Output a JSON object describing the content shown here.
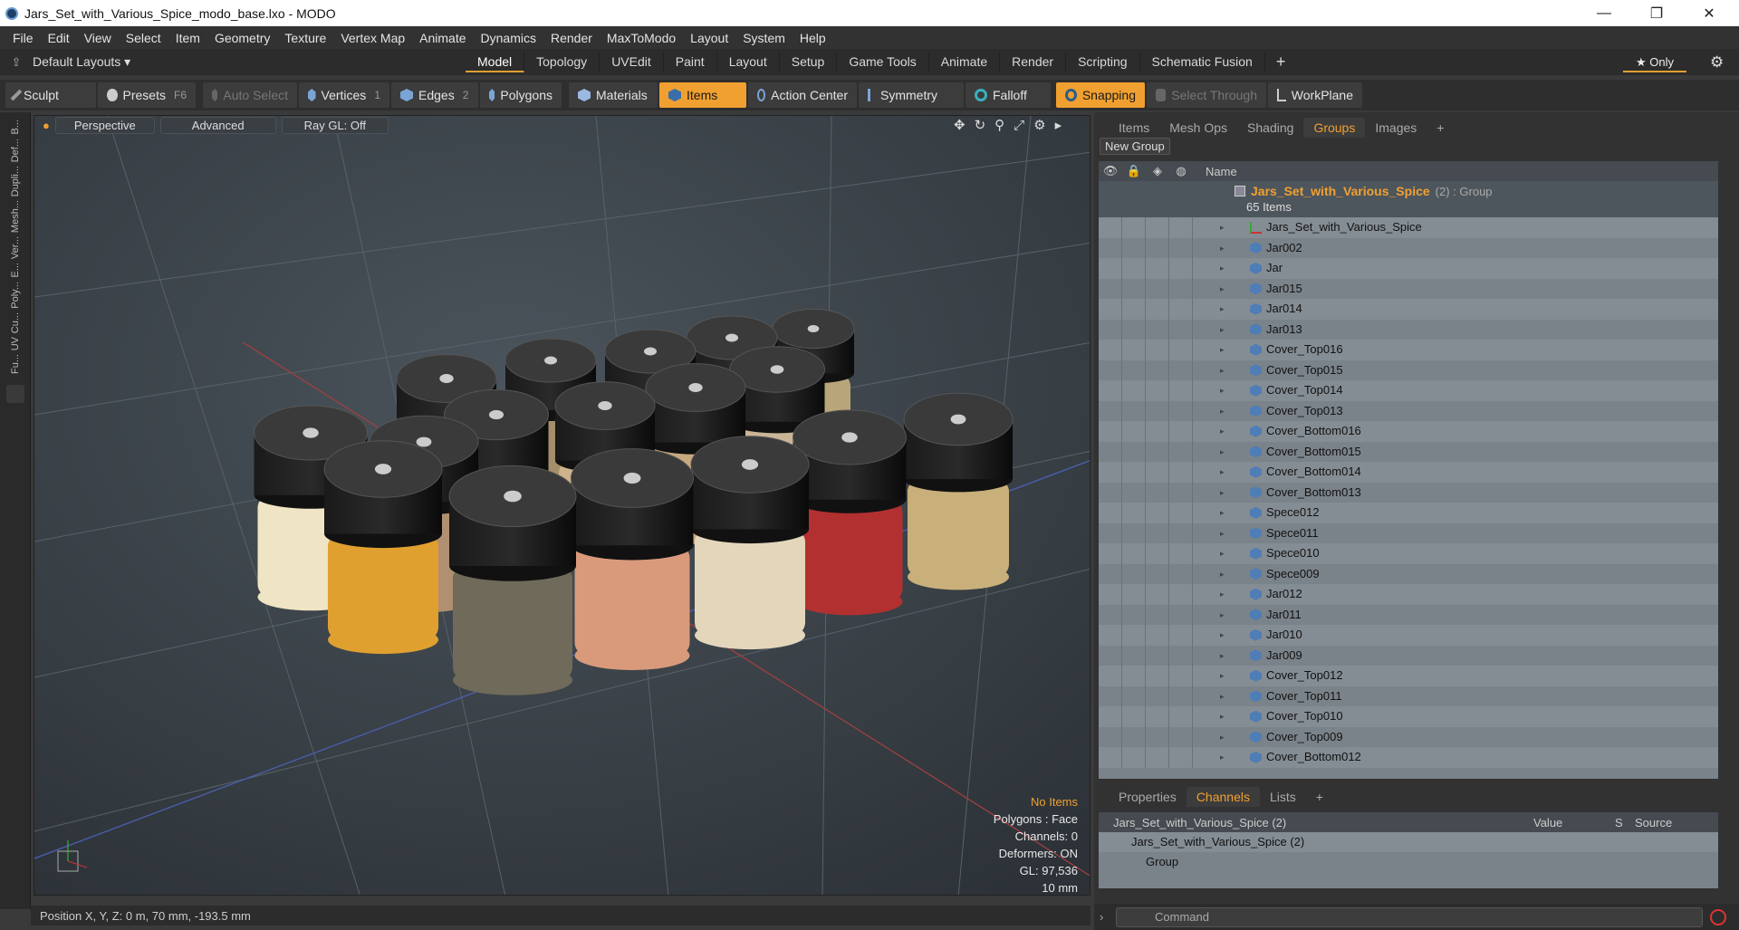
{
  "window": {
    "title": "Jars_Set_with_Various_Spice_modo_base.lxo - MODO",
    "min": "—",
    "max": "❐",
    "close": "✕"
  },
  "menu": [
    "File",
    "Edit",
    "View",
    "Select",
    "Item",
    "Geometry",
    "Texture",
    "Vertex Map",
    "Animate",
    "Dynamics",
    "Render",
    "MaxToModo",
    "Layout",
    "System",
    "Help"
  ],
  "layouts": {
    "label": "Default Layouts ▾",
    "only": "★ Only"
  },
  "tabs": [
    "Model",
    "Topology",
    "UVEdit",
    "Paint",
    "Layout",
    "Setup",
    "Game Tools",
    "Animate",
    "Render",
    "Scripting",
    "Schematic Fusion"
  ],
  "toolbar": {
    "sculpt": "Sculpt",
    "presets": "Presets",
    "presets_key": "F6",
    "auto_select": "Auto Select",
    "vertices": "Vertices",
    "vertices_n": "1",
    "edges": "Edges",
    "edges_n": "2",
    "polygons": "Polygons",
    "materials": "Materials",
    "items": "Items",
    "action_center": "Action Center",
    "symmetry": "Symmetry",
    "falloff": "Falloff",
    "snapping": "Snapping",
    "select_through": "Select Through",
    "workplane": "WorkPlane"
  },
  "left_tools": [
    "B...",
    "Def...",
    "Dupli...",
    "Mesh...",
    "Ver...",
    "E...",
    "Poly...",
    "Cu...",
    "UV",
    "Fu..."
  ],
  "viewport": {
    "perspective": "Perspective",
    "advanced": "Advanced",
    "raygl": "Ray GL: Off",
    "stats": {
      "items": "No Items",
      "polygons": "Polygons : Face",
      "channels": "Channels: 0",
      "deformers": "Deformers: ON",
      "gl": "GL: 97,536",
      "unit": "10 mm"
    }
  },
  "status": "Position X, Y, Z:  0 m, 70 mm, -193.5 mm",
  "groups_panel": {
    "tabs": [
      "Items",
      "Mesh Ops",
      "Shading",
      "Groups",
      "Images"
    ],
    "new_group": "New Group",
    "name_col": "Name",
    "group_name": "Jars_Set_with_Various_Spice",
    "group_suffix": "(2) : Group",
    "group_count": "65 Items",
    "items": [
      "Jars_Set_with_Various_Spice",
      "Jar002",
      "Jar",
      "Jar015",
      "Jar014",
      "Jar013",
      "Cover_Top016",
      "Cover_Top015",
      "Cover_Top014",
      "Cover_Top013",
      "Cover_Bottom016",
      "Cover_Bottom015",
      "Cover_Bottom014",
      "Cover_Bottom013",
      "Spece012",
      "Spece011",
      "Spece010",
      "Spece009",
      "Jar012",
      "Jar011",
      "Jar010",
      "Jar009",
      "Cover_Top012",
      "Cover_Top011",
      "Cover_Top010",
      "Cover_Top009",
      "Cover_Bottom012"
    ]
  },
  "props_panel": {
    "tabs": [
      "Properties",
      "Channels",
      "Lists"
    ],
    "header": "Jars_Set_with_Various_Spice (2)",
    "cols": [
      "Value",
      "S",
      "Source"
    ],
    "rows": [
      "Jars_Set_with_Various_Spice (2)",
      "Group"
    ]
  },
  "command": {
    "placeholder": "Command"
  },
  "colors": {
    "accent": "#f0a030",
    "tree_bg": "#7b838a",
    "viewport_bg": "#3b434a"
  }
}
